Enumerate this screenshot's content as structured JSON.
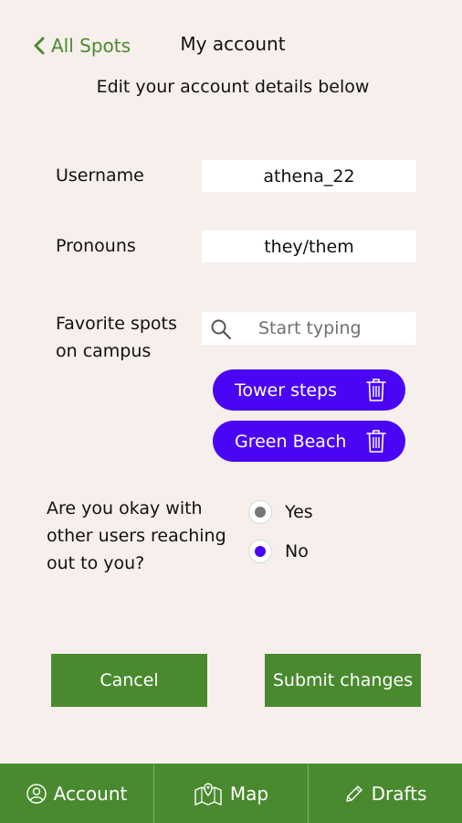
{
  "header": {
    "back_label": "All Spots",
    "title": "My account",
    "subtitle": "Edit your account details below"
  },
  "form": {
    "username": {
      "label": "Username",
      "value": "athena_22"
    },
    "pronouns": {
      "label": "Pronouns",
      "value": "they/them"
    },
    "favorites": {
      "label_line1": "Favorite spots",
      "label_line2": "on campus",
      "placeholder": "Start typing",
      "chips": [
        "Tower steps",
        "Green Beach"
      ]
    },
    "contact": {
      "question_line1": "Are you okay with",
      "question_line2": "other users reaching",
      "question_line3": "out to you?",
      "options": [
        "Yes",
        "No"
      ],
      "selected": "No"
    }
  },
  "actions": {
    "cancel": "Cancel",
    "submit": "Submit changes"
  },
  "nav": {
    "account": "Account",
    "map": "Map",
    "drafts": "Drafts"
  },
  "colors": {
    "background": "#f6efeb",
    "accent_green": "#4a8a2f",
    "chip_purple": "#4a06f4",
    "radio_selected": "#4a06f4",
    "radio_unselected_dot": "#777777"
  }
}
